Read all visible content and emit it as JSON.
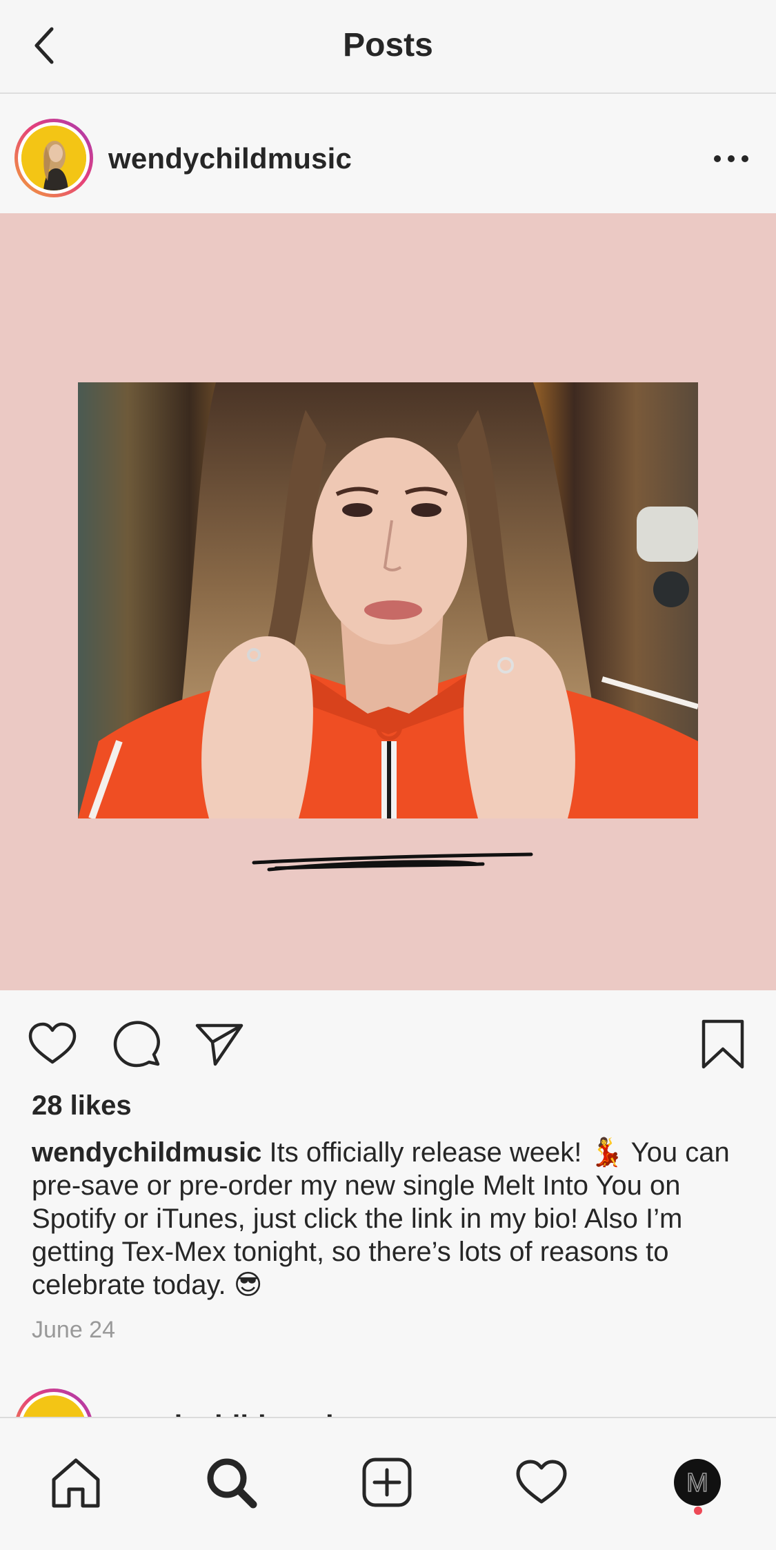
{
  "header": {
    "title": "Posts",
    "back_icon": "chevron-left-icon"
  },
  "post": {
    "username": "wendychildmusic",
    "more_icon": "ellipsis-icon",
    "image_background": "#ebc9c4",
    "likes": "28 likes",
    "caption_user": "wendychildmusic",
    "caption_text": "Its officially release week! 💃 You can pre-save or pre-order my new single Melt Into You on Spotify or iTunes, just click the link in my bio! Also I’m getting Tex-Mex tonight, so there’s lots of reasons to celebrate today. 😎",
    "date": "June 24",
    "actions": {
      "like_icon": "heart-outline-icon",
      "comment_icon": "comment-bubble-icon",
      "share_icon": "paper-plane-icon",
      "save_icon": "bookmark-icon"
    }
  },
  "next_post": {
    "username": "wendychildmusic"
  },
  "tabbar": {
    "items": [
      {
        "name": "home",
        "icon": "home-icon"
      },
      {
        "name": "search",
        "icon": "search-icon",
        "active": true
      },
      {
        "name": "new-post",
        "icon": "plus-square-icon"
      },
      {
        "name": "activity",
        "icon": "heart-outline-icon"
      },
      {
        "name": "profile",
        "icon": "profile-avatar-icon",
        "avatar_letter": "M"
      }
    ],
    "notification_color": "#ed4956"
  }
}
